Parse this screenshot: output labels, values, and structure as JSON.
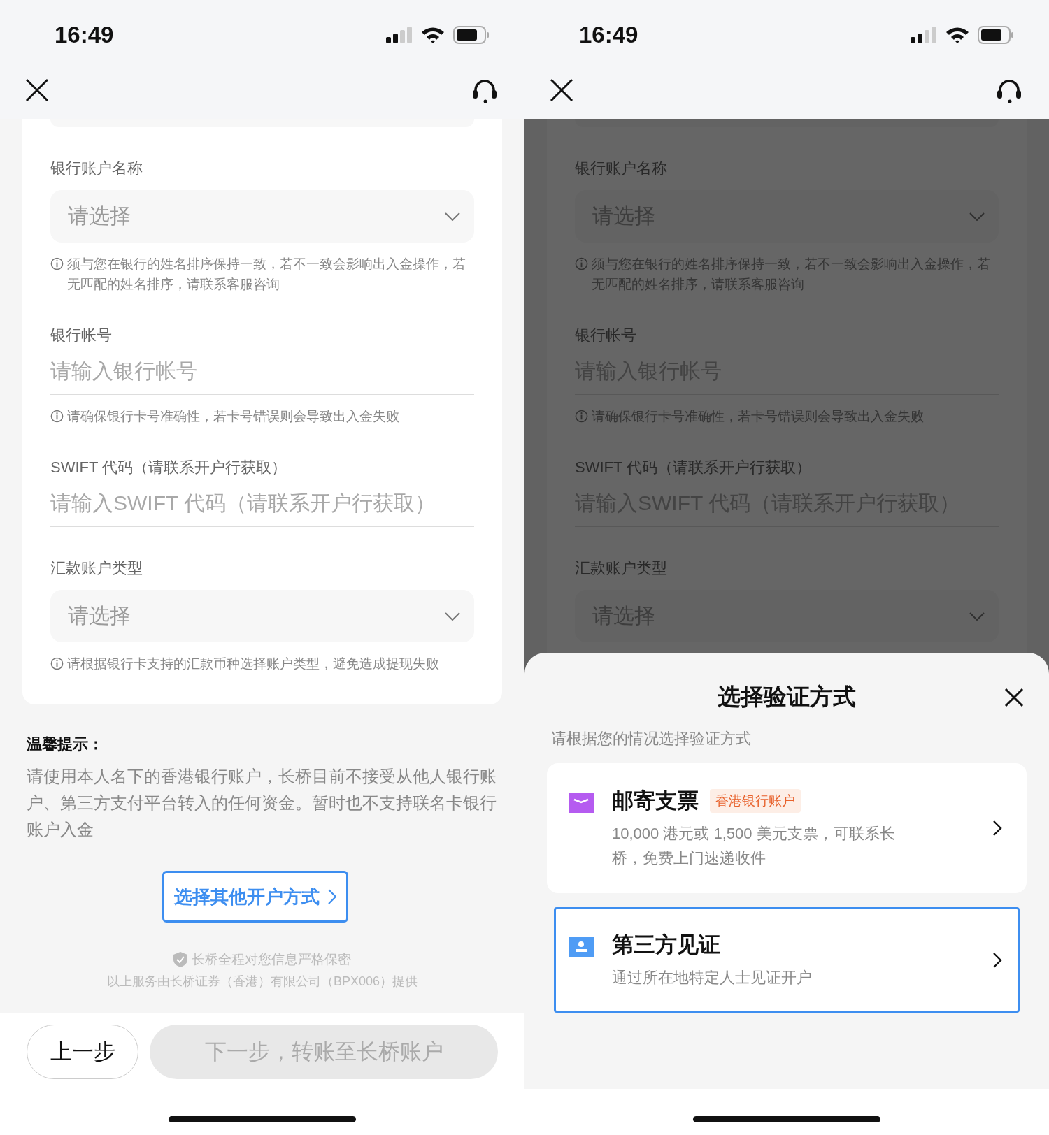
{
  "screens": [
    {
      "status_bar": {
        "time": "16:49"
      },
      "form": {
        "fields": [
          {
            "kind": "select",
            "label": "银行账户名称",
            "placeholder": "请选择",
            "hint": "须与您在银行的姓名排序保持一致，若不一致会影响出入金操作，若无匹配的姓名排序，请联系客服咨询"
          },
          {
            "kind": "input",
            "label": "银行帐号",
            "placeholder": "请输入银行帐号",
            "hint": "请确保银行卡号准确性，若卡号错误则会导致出入金失败"
          },
          {
            "kind": "input",
            "label": "SWIFT 代码（请联系开户行获取）",
            "placeholder": "请输入SWIFT 代码（请联系开户行获取）"
          },
          {
            "kind": "select",
            "label": "汇款账户类型",
            "placeholder": "请选择",
            "hint": "请根据银行卡支持的汇款币种选择账户类型，避免造成提现失败"
          }
        ]
      },
      "notice": {
        "title": "温馨提示：",
        "text": "请使用本人名下的香港银行账户，长桥目前不接受从他人银行账户、第三方支付平台转入的任何资金。暂时也不支持联名卡银行账户入金"
      },
      "other_method_button": "选择其他开户方式",
      "privacy_note": "长桥全程对您信息严格保密",
      "provider_note": "以上服务由长桥证券（香港）有限公司（BPX006）提供",
      "buttons": [
        {
          "label": "上一步",
          "disabled": false
        },
        {
          "label": "下一步，转账至长桥账户",
          "disabled": true
        }
      ]
    },
    {
      "status_bar": {
        "time": "16:49"
      },
      "form": {
        "fields": [
          {
            "kind": "select",
            "label": "银行账户名称",
            "placeholder": "请选择",
            "hint": "须与您在银行的姓名排序保持一致，若不一致会影响出入金操作，若无匹配的姓名排序，请联系客服咨询"
          },
          {
            "kind": "input",
            "label": "银行帐号",
            "placeholder": "请输入银行帐号",
            "hint": "请确保银行卡号准确性，若卡号错误则会导致出入金失败"
          },
          {
            "kind": "input",
            "label": "SWIFT 代码（请联系开户行获取）",
            "placeholder": "请输入SWIFT 代码（请联系开户行获取）"
          },
          {
            "kind": "select",
            "label": "汇款账户类型",
            "placeholder": "请选择"
          }
        ]
      },
      "sheet": {
        "title": "选择验证方式",
        "subtitle": "请根据您的情况选择验证方式",
        "options": [
          {
            "kind": "envelope",
            "title": "邮寄支票",
            "tag": "香港银行账户",
            "description": "10,000 港元或 1,500 美元支票，可联系长桥，免费上门速递收件",
            "selected": false
          },
          {
            "kind": "id-card",
            "title": "第三方见证",
            "description": "通过所在地特定人士见证开户",
            "selected": true
          }
        ]
      }
    }
  ]
}
